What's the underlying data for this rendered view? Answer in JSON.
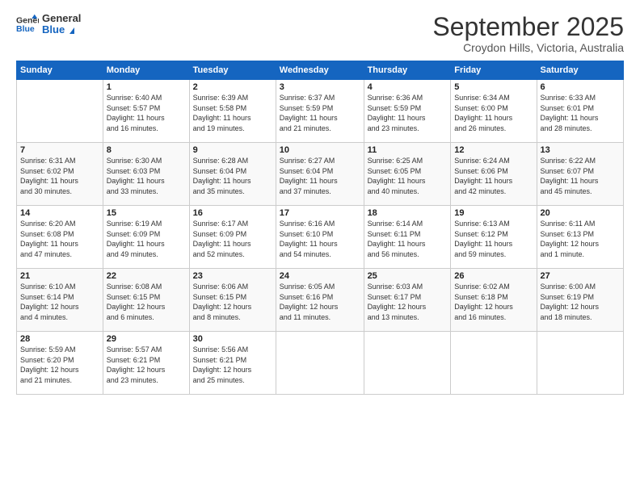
{
  "header": {
    "logo_line1": "General",
    "logo_line2": "Blue",
    "month": "September 2025",
    "location": "Croydon Hills, Victoria, Australia"
  },
  "weekdays": [
    "Sunday",
    "Monday",
    "Tuesday",
    "Wednesday",
    "Thursday",
    "Friday",
    "Saturday"
  ],
  "weeks": [
    [
      {
        "day": "",
        "info": ""
      },
      {
        "day": "1",
        "info": "Sunrise: 6:40 AM\nSunset: 5:57 PM\nDaylight: 11 hours\nand 16 minutes."
      },
      {
        "day": "2",
        "info": "Sunrise: 6:39 AM\nSunset: 5:58 PM\nDaylight: 11 hours\nand 19 minutes."
      },
      {
        "day": "3",
        "info": "Sunrise: 6:37 AM\nSunset: 5:59 PM\nDaylight: 11 hours\nand 21 minutes."
      },
      {
        "day": "4",
        "info": "Sunrise: 6:36 AM\nSunset: 5:59 PM\nDaylight: 11 hours\nand 23 minutes."
      },
      {
        "day": "5",
        "info": "Sunrise: 6:34 AM\nSunset: 6:00 PM\nDaylight: 11 hours\nand 26 minutes."
      },
      {
        "day": "6",
        "info": "Sunrise: 6:33 AM\nSunset: 6:01 PM\nDaylight: 11 hours\nand 28 minutes."
      }
    ],
    [
      {
        "day": "7",
        "info": "Sunrise: 6:31 AM\nSunset: 6:02 PM\nDaylight: 11 hours\nand 30 minutes."
      },
      {
        "day": "8",
        "info": "Sunrise: 6:30 AM\nSunset: 6:03 PM\nDaylight: 11 hours\nand 33 minutes."
      },
      {
        "day": "9",
        "info": "Sunrise: 6:28 AM\nSunset: 6:04 PM\nDaylight: 11 hours\nand 35 minutes."
      },
      {
        "day": "10",
        "info": "Sunrise: 6:27 AM\nSunset: 6:04 PM\nDaylight: 11 hours\nand 37 minutes."
      },
      {
        "day": "11",
        "info": "Sunrise: 6:25 AM\nSunset: 6:05 PM\nDaylight: 11 hours\nand 40 minutes."
      },
      {
        "day": "12",
        "info": "Sunrise: 6:24 AM\nSunset: 6:06 PM\nDaylight: 11 hours\nand 42 minutes."
      },
      {
        "day": "13",
        "info": "Sunrise: 6:22 AM\nSunset: 6:07 PM\nDaylight: 11 hours\nand 45 minutes."
      }
    ],
    [
      {
        "day": "14",
        "info": "Sunrise: 6:20 AM\nSunset: 6:08 PM\nDaylight: 11 hours\nand 47 minutes."
      },
      {
        "day": "15",
        "info": "Sunrise: 6:19 AM\nSunset: 6:09 PM\nDaylight: 11 hours\nand 49 minutes."
      },
      {
        "day": "16",
        "info": "Sunrise: 6:17 AM\nSunset: 6:09 PM\nDaylight: 11 hours\nand 52 minutes."
      },
      {
        "day": "17",
        "info": "Sunrise: 6:16 AM\nSunset: 6:10 PM\nDaylight: 11 hours\nand 54 minutes."
      },
      {
        "day": "18",
        "info": "Sunrise: 6:14 AM\nSunset: 6:11 PM\nDaylight: 11 hours\nand 56 minutes."
      },
      {
        "day": "19",
        "info": "Sunrise: 6:13 AM\nSunset: 6:12 PM\nDaylight: 11 hours\nand 59 minutes."
      },
      {
        "day": "20",
        "info": "Sunrise: 6:11 AM\nSunset: 6:13 PM\nDaylight: 12 hours\nand 1 minute."
      }
    ],
    [
      {
        "day": "21",
        "info": "Sunrise: 6:10 AM\nSunset: 6:14 PM\nDaylight: 12 hours\nand 4 minutes."
      },
      {
        "day": "22",
        "info": "Sunrise: 6:08 AM\nSunset: 6:15 PM\nDaylight: 12 hours\nand 6 minutes."
      },
      {
        "day": "23",
        "info": "Sunrise: 6:06 AM\nSunset: 6:15 PM\nDaylight: 12 hours\nand 8 minutes."
      },
      {
        "day": "24",
        "info": "Sunrise: 6:05 AM\nSunset: 6:16 PM\nDaylight: 12 hours\nand 11 minutes."
      },
      {
        "day": "25",
        "info": "Sunrise: 6:03 AM\nSunset: 6:17 PM\nDaylight: 12 hours\nand 13 minutes."
      },
      {
        "day": "26",
        "info": "Sunrise: 6:02 AM\nSunset: 6:18 PM\nDaylight: 12 hours\nand 16 minutes."
      },
      {
        "day": "27",
        "info": "Sunrise: 6:00 AM\nSunset: 6:19 PM\nDaylight: 12 hours\nand 18 minutes."
      }
    ],
    [
      {
        "day": "28",
        "info": "Sunrise: 5:59 AM\nSunset: 6:20 PM\nDaylight: 12 hours\nand 21 minutes."
      },
      {
        "day": "29",
        "info": "Sunrise: 5:57 AM\nSunset: 6:21 PM\nDaylight: 12 hours\nand 23 minutes."
      },
      {
        "day": "30",
        "info": "Sunrise: 5:56 AM\nSunset: 6:21 PM\nDaylight: 12 hours\nand 25 minutes."
      },
      {
        "day": "",
        "info": ""
      },
      {
        "day": "",
        "info": ""
      },
      {
        "day": "",
        "info": ""
      },
      {
        "day": "",
        "info": ""
      }
    ]
  ]
}
